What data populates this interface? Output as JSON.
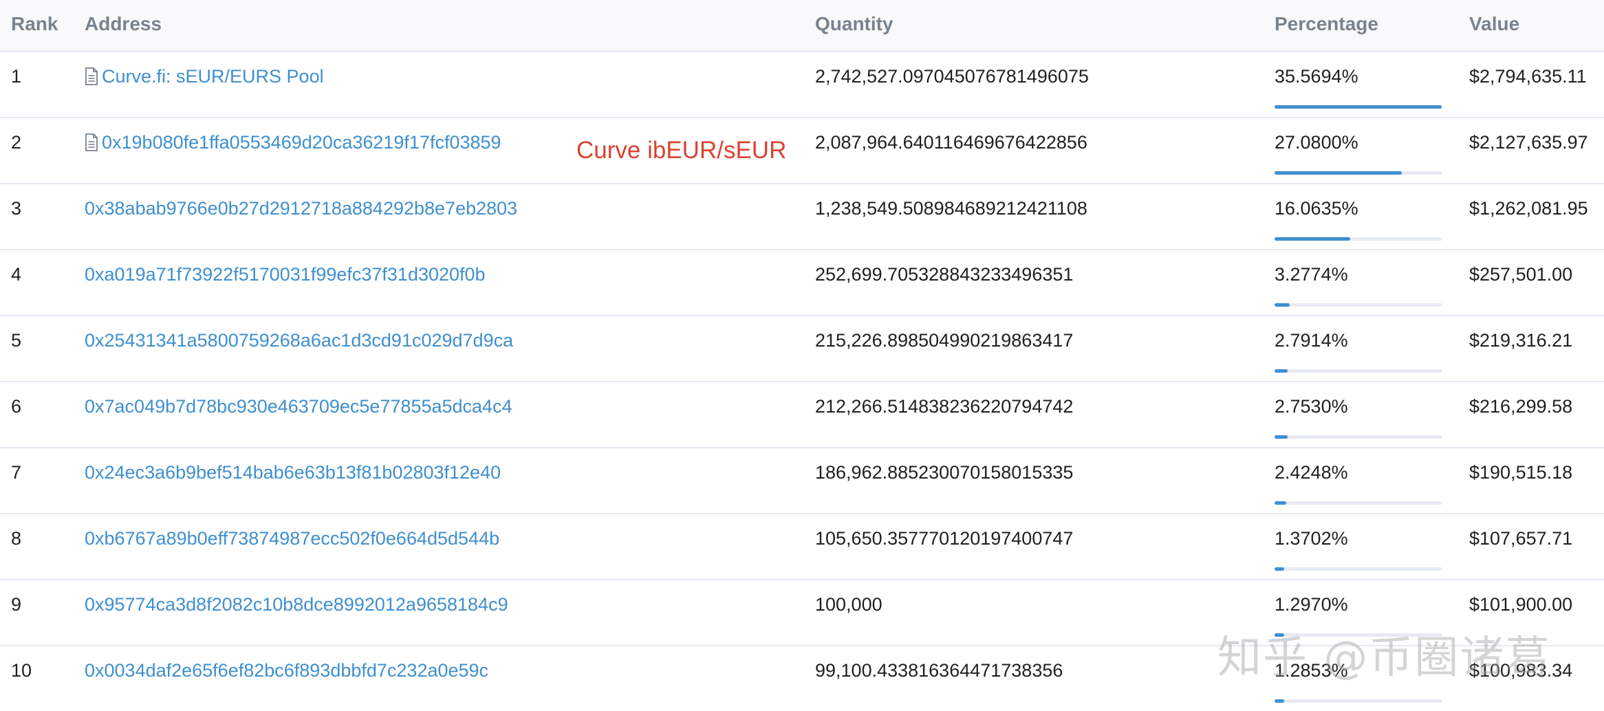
{
  "columns": {
    "rank": "Rank",
    "address": "Address",
    "quantity": "Quantity",
    "percentage": "Percentage",
    "value": "Value"
  },
  "annotation": "Curve ibEUR/sEUR",
  "watermark": "知乎 @币圈诸葛",
  "colors": {
    "link": "#3f8fcf",
    "annotation": "#d9432f",
    "header_text": "#77838f",
    "bar": "#3f8fcf"
  },
  "rows": [
    {
      "rank": "1",
      "address": "Curve.fi: sEUR/EURS Pool",
      "is_contract": true,
      "quantity": "2,742,527.097045076781496075",
      "percentage": "35.5694%",
      "pct_value": 35.5694,
      "value": "$2,794,635.11"
    },
    {
      "rank": "2",
      "address": "0x19b080fe1ffa0553469d20ca36219f17fcf03859",
      "is_contract": true,
      "quantity": "2,087,964.640116469676422856",
      "percentage": "27.0800%",
      "pct_value": 27.08,
      "value": "$2,127,635.97"
    },
    {
      "rank": "3",
      "address": "0x38abab9766e0b27d2912718a884292b8e7eb2803",
      "is_contract": false,
      "quantity": "1,238,549.508984689212421108",
      "percentage": "16.0635%",
      "pct_value": 16.0635,
      "value": "$1,262,081.95"
    },
    {
      "rank": "4",
      "address": "0xa019a71f73922f5170031f99efc37f31d3020f0b",
      "is_contract": false,
      "quantity": "252,699.705328843233496351",
      "percentage": "3.2774%",
      "pct_value": 3.2774,
      "value": "$257,501.00"
    },
    {
      "rank": "5",
      "address": "0x25431341a5800759268a6ac1d3cd91c029d7d9ca",
      "is_contract": false,
      "quantity": "215,226.898504990219863417",
      "percentage": "2.7914%",
      "pct_value": 2.7914,
      "value": "$219,316.21"
    },
    {
      "rank": "6",
      "address": "0x7ac049b7d78bc930e463709ec5e77855a5dca4c4",
      "is_contract": false,
      "quantity": "212,266.514838236220794742",
      "percentage": "2.7530%",
      "pct_value": 2.753,
      "value": "$216,299.58"
    },
    {
      "rank": "7",
      "address": "0x24ec3a6b9bef514bab6e63b13f81b02803f12e40",
      "is_contract": false,
      "quantity": "186,962.885230070158015335",
      "percentage": "2.4248%",
      "pct_value": 2.4248,
      "value": "$190,515.18"
    },
    {
      "rank": "8",
      "address": "0xb6767a89b0eff73874987ecc502f0e664d5d544b",
      "is_contract": false,
      "quantity": "105,650.357770120197400747",
      "percentage": "1.3702%",
      "pct_value": 1.3702,
      "value": "$107,657.71"
    },
    {
      "rank": "9",
      "address": "0x95774ca3d8f2082c10b8dce8992012a9658184c9",
      "is_contract": false,
      "quantity": "100,000",
      "percentage": "1.2970%",
      "pct_value": 1.297,
      "value": "$101,900.00"
    },
    {
      "rank": "10",
      "address": "0x0034daf2e65f6ef82bc6f893dbbfd7c232a0e59c",
      "is_contract": false,
      "quantity": "99,100.433816364471738356",
      "percentage": "1.2853%",
      "pct_value": 1.2853,
      "value": "$100,983.34"
    }
  ]
}
